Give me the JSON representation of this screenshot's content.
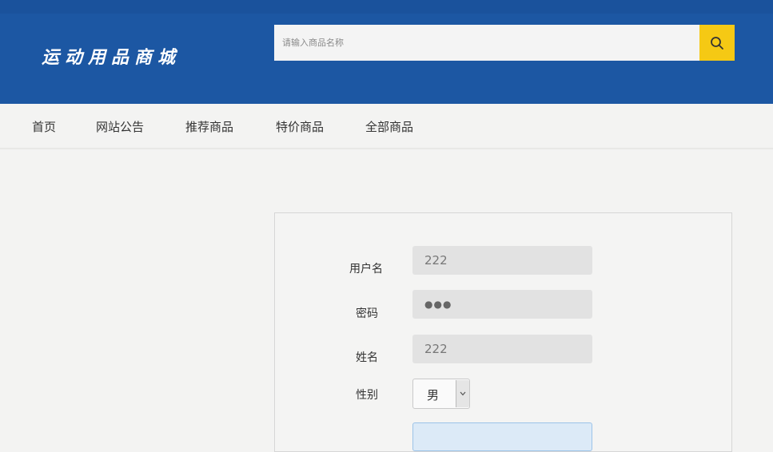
{
  "header": {
    "logo_text": "运动用品商城",
    "search": {
      "placeholder": "请输入商品名称",
      "value": ""
    },
    "search_icon": "search-icon"
  },
  "nav": {
    "items": [
      {
        "label": "首页"
      },
      {
        "label": "网站公告"
      },
      {
        "label": "推荐商品"
      },
      {
        "label": "特价商品"
      },
      {
        "label": "全部商品"
      }
    ]
  },
  "form": {
    "username": {
      "label": "用户名",
      "value": "222"
    },
    "password": {
      "label": "密码",
      "value": "●●●"
    },
    "realname": {
      "label": "姓名",
      "value": "222"
    },
    "gender": {
      "label": "性别",
      "value": "男",
      "icon": "chevron-down-icon"
    }
  },
  "colors": {
    "header_bg": "#1c57a3",
    "search_button": "#f5c914",
    "page_bg": "#f3f3f2"
  }
}
